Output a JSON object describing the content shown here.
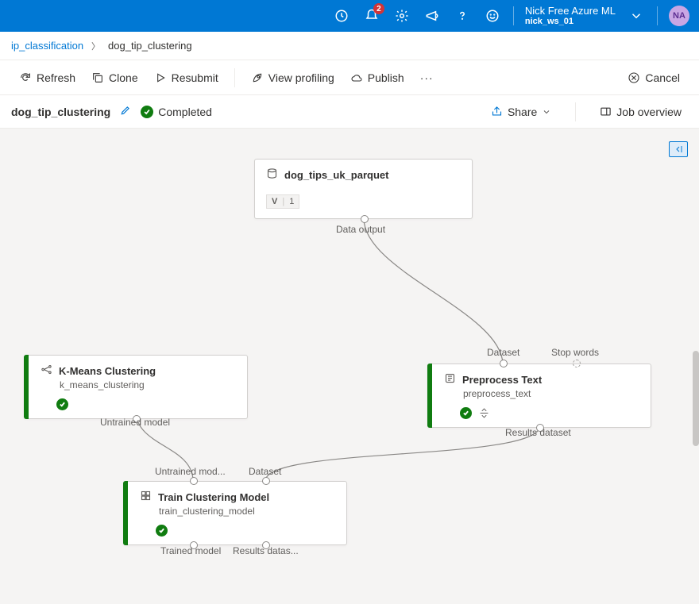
{
  "topbar": {
    "notification_count": "2",
    "subscription": "Nick Free Azure ML",
    "workspace": "nick_ws_01",
    "avatar": "NA"
  },
  "breadcrumb": {
    "parent": "ip_classification",
    "current": "dog_tip_clustering"
  },
  "toolbar": {
    "refresh": "Refresh",
    "clone": "Clone",
    "resubmit": "Resubmit",
    "profiling": "View profiling",
    "publish": "Publish",
    "cancel": "Cancel"
  },
  "subheader": {
    "title": "dog_tip_clustering",
    "status": "Completed",
    "share": "Share",
    "job_overview": "Job overview"
  },
  "nodes": {
    "dataset": {
      "title": "dog_tips_uk_parquet",
      "version_label": "V",
      "version": "1",
      "out1": "Data output"
    },
    "kmeans": {
      "title": "K-Means Clustering",
      "sub": "k_means_clustering",
      "out1": "Untrained model"
    },
    "preprocess": {
      "title": "Preprocess Text",
      "sub": "preprocess_text",
      "in1": "Dataset",
      "in2": "Stop words",
      "out1": "Results dataset"
    },
    "train": {
      "title": "Train Clustering Model",
      "sub": "train_clustering_model",
      "in1": "Untrained mod...",
      "in2": "Dataset",
      "out1": "Trained model",
      "out2": "Results datas..."
    }
  }
}
